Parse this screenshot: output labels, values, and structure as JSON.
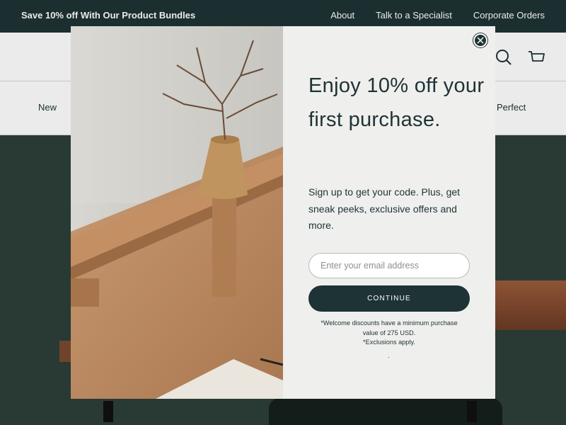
{
  "announcement": {
    "promo": "Save 10% off With Our Product Bundles",
    "links": [
      "About",
      "Talk to a Specialist",
      "Corporate Orders"
    ]
  },
  "header": {
    "search_icon": "search-icon",
    "cart_icon": "cart-icon"
  },
  "nav": {
    "items": [
      "New",
      "Perfect"
    ]
  },
  "modal": {
    "headline": "Enjoy 10% off your first purchase.",
    "subtext": "Sign up to get your code. Plus, get sneak peeks, exclusive offers and more.",
    "email_placeholder": "Enter your email address",
    "email_value": "",
    "continue_label": "CONTINUE",
    "disclaimer": [
      "*Welcome discounts have a minimum purchase value of 275 USD.",
      "*Exclusions apply."
    ],
    "trailing_dot": ".",
    "close_icon": "close-icon"
  },
  "colors": {
    "brand_dark": "#1e3335",
    "modal_bg": "#efefed",
    "hero_bg": "#2c3f38"
  }
}
